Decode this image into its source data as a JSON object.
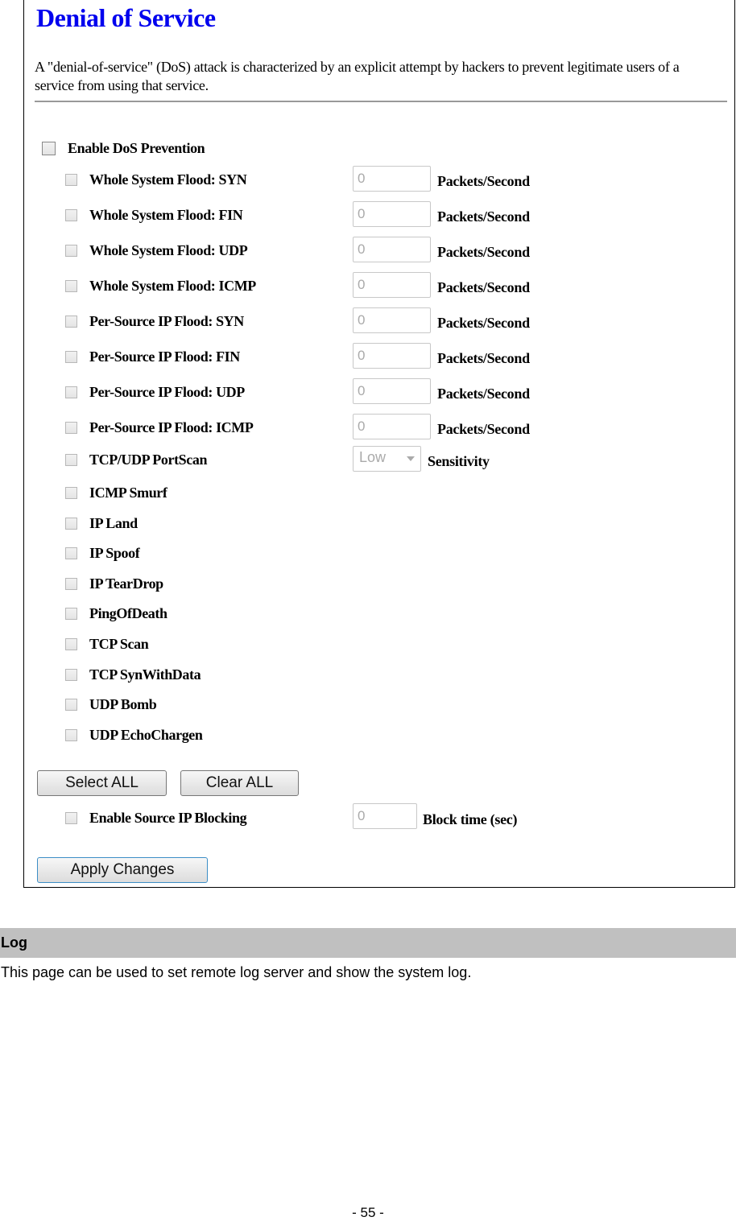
{
  "screenshot": {
    "title": "Denial of Service",
    "description": "A \"denial-of-service\" (DoS) attack is characterized by an explicit attempt by hackers to prevent legitimate users of a service from using that service.",
    "enable_dos": {
      "label": "Enable DoS Prevention",
      "checked": false
    },
    "flood_rows": [
      {
        "label": "Whole System Flood: SYN",
        "value": "0",
        "unit": "Packets/Second",
        "checked": false
      },
      {
        "label": "Whole System Flood: FIN",
        "value": "0",
        "unit": "Packets/Second",
        "checked": false
      },
      {
        "label": "Whole System Flood: UDP",
        "value": "0",
        "unit": "Packets/Second",
        "checked": false
      },
      {
        "label": "Whole System Flood: ICMP",
        "value": "0",
        "unit": "Packets/Second",
        "checked": false
      },
      {
        "label": "Per-Source IP Flood: SYN",
        "value": "0",
        "unit": "Packets/Second",
        "checked": false
      },
      {
        "label": "Per-Source IP Flood: FIN",
        "value": "0",
        "unit": "Packets/Second",
        "checked": false
      },
      {
        "label": "Per-Source IP Flood: UDP",
        "value": "0",
        "unit": "Packets/Second",
        "checked": false
      },
      {
        "label": "Per-Source IP Flood: ICMP",
        "value": "0",
        "unit": "Packets/Second",
        "checked": false
      }
    ],
    "portscan": {
      "label": "TCP/UDP PortScan",
      "sensitivity_value": "Low",
      "sensitivity_label": "Sensitivity",
      "checked": false
    },
    "simple_rows": [
      {
        "label": "ICMP Smurf",
        "checked": false
      },
      {
        "label": "IP Land",
        "checked": false
      },
      {
        "label": "IP Spoof",
        "checked": false
      },
      {
        "label": "IP TearDrop",
        "checked": false
      },
      {
        "label": "PingOfDeath",
        "checked": false
      },
      {
        "label": "TCP Scan",
        "checked": false
      },
      {
        "label": "TCP SynWithData",
        "checked": false
      },
      {
        "label": "UDP Bomb",
        "checked": false
      },
      {
        "label": "UDP EchoChargen",
        "checked": false
      }
    ],
    "select_all_label": "Select ALL",
    "clear_all_label": "Clear ALL",
    "source_ip_blocking": {
      "label": "Enable Source IP Blocking",
      "value": "0",
      "unit": "Block time (sec)",
      "checked": false
    },
    "apply_label": "Apply Changes"
  },
  "log_section": {
    "heading": "Log",
    "description": "This page can be used to set remote log server and show the system log."
  },
  "page_number": "- 55 -"
}
